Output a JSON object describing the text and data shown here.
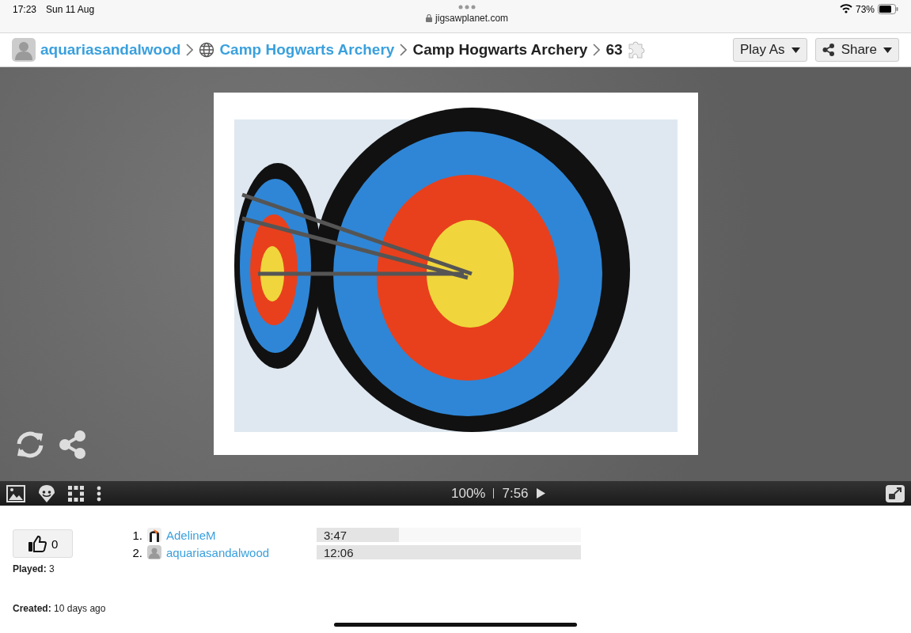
{
  "status_bar": {
    "time": "17:23",
    "date": "Sun 11 Aug",
    "url": "jigsawplanet.com",
    "battery": "73%"
  },
  "breadcrumb": {
    "user": "aquariasandalwood",
    "folder": "Camp Hogwarts Archery",
    "title": "Camp Hogwarts Archery",
    "pieces": "63"
  },
  "header_buttons": [
    {
      "label": "Play As"
    },
    {
      "label": "Share"
    }
  ],
  "toolbar": {
    "zoom": "100%",
    "time": "7:56"
  },
  "likes": "0",
  "played": {
    "label": "Played:",
    "value": "3"
  },
  "created": {
    "label": "Created:",
    "value": "10 days ago"
  },
  "scores": [
    {
      "rank": "1.",
      "name": "AdelineM",
      "time": "3:47",
      "level": 0.31,
      "kind": "picture"
    },
    {
      "rank": "2.",
      "name": "aquariasandalwood",
      "time": "12:06",
      "level": 1,
      "kind": "default"
    }
  ]
}
